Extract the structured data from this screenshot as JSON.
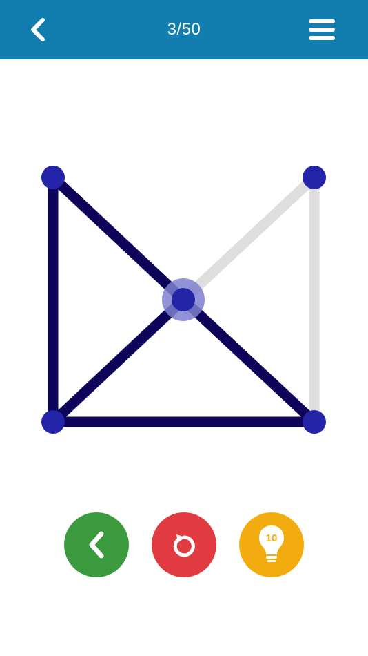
{
  "header": {
    "level_text": "3/50",
    "back_icon": "chevron-left-icon",
    "menu_icon": "hamburger-menu-icon"
  },
  "puzzle": {
    "colors": {
      "drawn": "#0e0459",
      "undrawn": "#dedede",
      "node": "#2424a8",
      "active_halo": "#7e80cf"
    },
    "nodes": [
      {
        "id": "top-left"
      },
      {
        "id": "top-right"
      },
      {
        "id": "center",
        "active": true
      },
      {
        "id": "bottom-left"
      },
      {
        "id": "bottom-right"
      }
    ],
    "edges": [
      {
        "from": "top-left",
        "to": "bottom-left",
        "drawn": true
      },
      {
        "from": "top-left",
        "to": "center",
        "drawn": true
      },
      {
        "from": "center",
        "to": "bottom-right",
        "drawn": true
      },
      {
        "from": "bottom-left",
        "to": "bottom-right",
        "drawn": true
      },
      {
        "from": "bottom-left",
        "to": "center",
        "drawn": true
      },
      {
        "from": "center",
        "to": "top-right",
        "drawn": false
      },
      {
        "from": "top-right",
        "to": "bottom-right",
        "drawn": false
      }
    ]
  },
  "controls": {
    "undo": {
      "icon": "chevron-left-icon",
      "color": "#3b9a3d"
    },
    "reset": {
      "icon": "restart-icon",
      "color": "#e13a40"
    },
    "hint": {
      "icon": "lightbulb-icon",
      "color": "#f2ac10",
      "count": "10"
    }
  },
  "colors": {
    "header_bg": "#127daf",
    "background": "#ffffff"
  }
}
